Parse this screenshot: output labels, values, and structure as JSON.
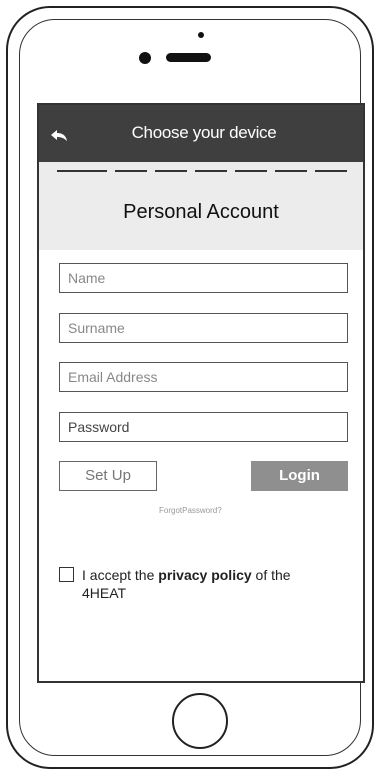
{
  "topbar": {
    "back_icon": "back-arrow-icon",
    "title": "Choose your device"
  },
  "header": {
    "title": "Personal Account",
    "progress_steps": 7
  },
  "form": {
    "name_placeholder": "Name",
    "surname_placeholder": "Surname",
    "email_placeholder": "Email Address",
    "password_placeholder": "Password"
  },
  "actions": {
    "setup_label": "Set Up",
    "login_label": "Login",
    "forgot_label": "ForgotPassword?"
  },
  "consent": {
    "text_before": "I accept the ",
    "link_text": "privacy policy",
    "text_after": " of the 4HEAT"
  },
  "colors": {
    "topbar": "#3f3f3f",
    "header_bg": "#ececec",
    "login_button": "#8f8f8f"
  }
}
